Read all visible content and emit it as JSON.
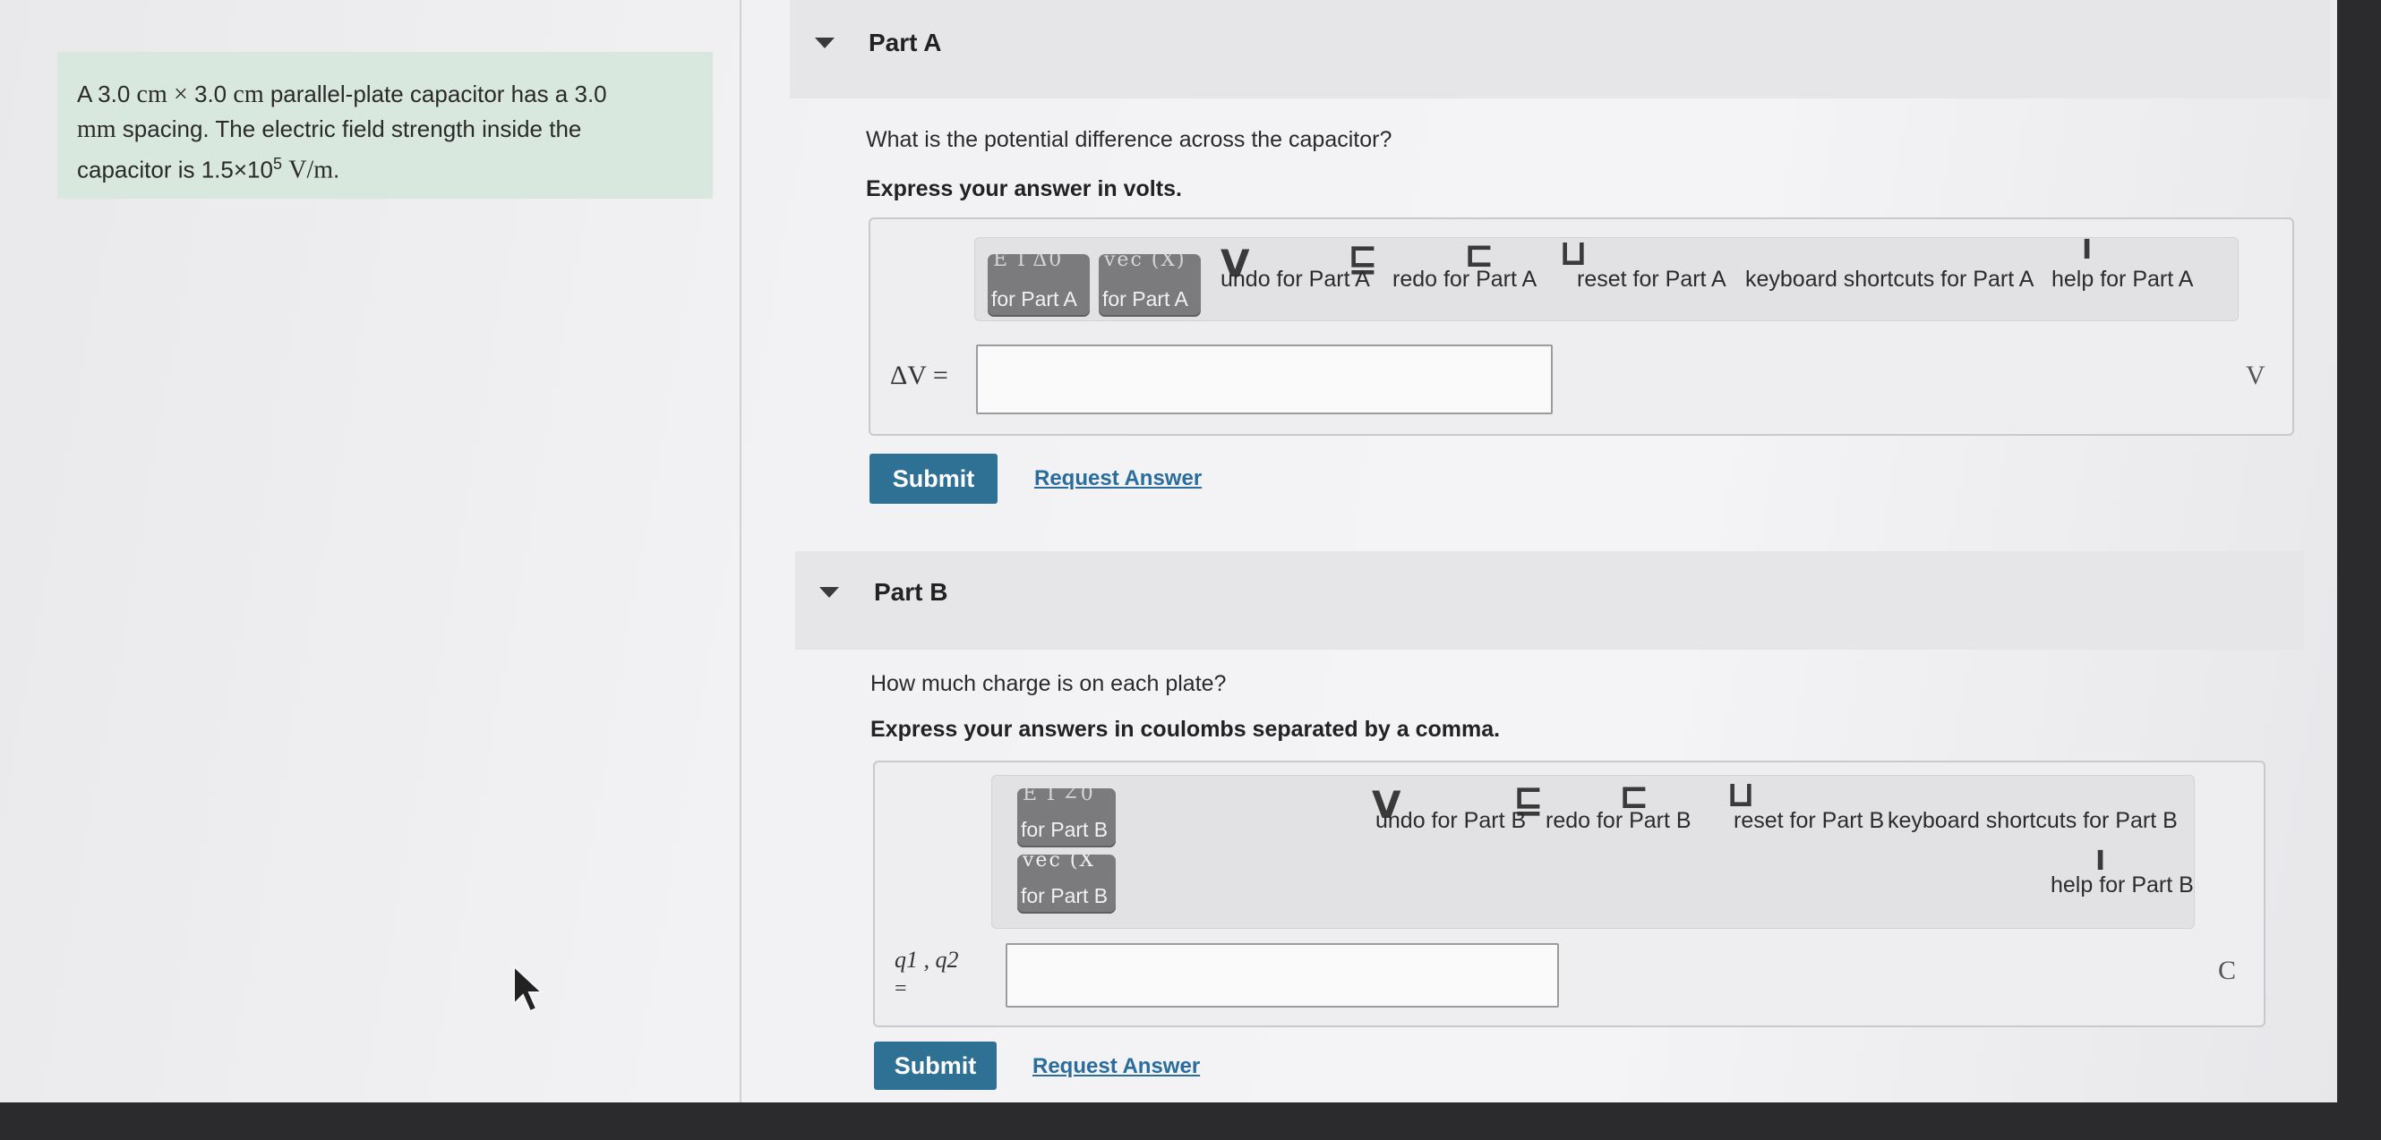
{
  "problem": {
    "line1_a": "A 3.0",
    "unit_cm1": "cm",
    "times": "×",
    "line1_b": "3.0",
    "unit_cm2": "cm",
    "line1_c": "parallel-plate capacitor has a 3.0",
    "unit_mm": "mm",
    "line2": "spacing. The electric field strength inside the",
    "line3_a": "capacitor is 1.5×10",
    "exponent": "5",
    "unit_field": "V/m",
    "period": "."
  },
  "part_a": {
    "title": "Part A",
    "question": "What is the potential difference across the capacitor?",
    "instruction": "Express your answer in volts.",
    "toolbar": {
      "templates_label": "for Part A",
      "templates_glyph": "E  ΓΔ0",
      "vec_label": "for Part A",
      "vec_glyph": "vec (X)",
      "undo": "undo for Part A",
      "redo": "redo for Part A",
      "reset": "reset for Part A",
      "shortcuts": "keyboard shortcuts for Part A",
      "help": "help for Part A"
    },
    "answer_label": "ΔV =",
    "answer_value": "",
    "unit": "V",
    "submit": "Submit",
    "request": "Request Answer"
  },
  "part_b": {
    "title": "Part B",
    "question": "How much charge is on each plate?",
    "instruction": "Express your answers in coulombs separated by a comma.",
    "toolbar": {
      "templates_label": "for Part B",
      "templates_glyph": "E  Γ∠0",
      "vec_label": "for Part B",
      "vec_glyph": "vec (X",
      "undo": "undo for Part B",
      "redo": "redo for Part B",
      "reset": "reset for Part B",
      "shortcuts": "keyboard shortcuts for Part B",
      "help": "help for Part B"
    },
    "answer_label": "q1 , q2",
    "answer_equals": "=",
    "answer_value": "",
    "unit": "C",
    "submit": "Submit",
    "request": "Request Answer"
  },
  "icons": [
    "collapse-caret-icon",
    "undo-icon",
    "redo-icon",
    "reset-icon",
    "help-icon",
    "mouse-pointer-icon"
  ]
}
